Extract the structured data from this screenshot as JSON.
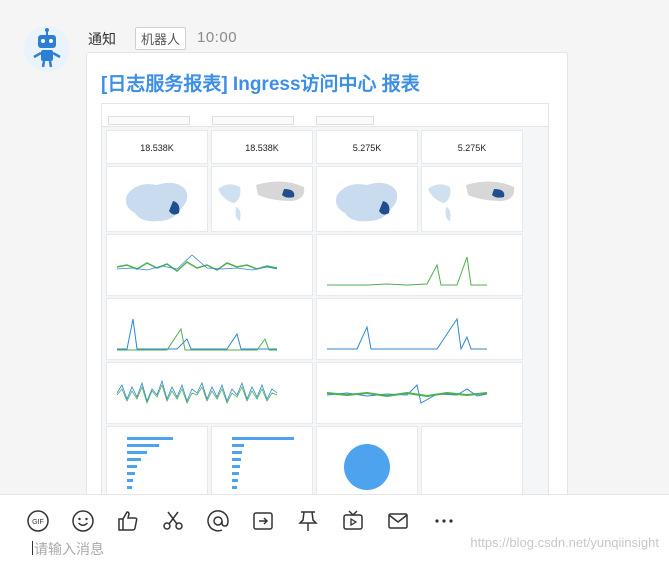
{
  "message": {
    "sender": "通知",
    "badge": "机器人",
    "time": "10:00",
    "title": "[日志服务报表] Ingress访问中心 报表"
  },
  "report": {
    "stats": [
      "18.538K",
      "18.538K",
      "5.275K",
      "5.275K"
    ]
  },
  "toolbar": {
    "icons": [
      "gif-icon",
      "emoji-icon",
      "thumbs-up-icon",
      "scissors-icon",
      "mention-icon",
      "share-icon",
      "pin-icon",
      "video-icon",
      "mail-icon",
      "more-icon"
    ],
    "input_placeholder": "请输入消息"
  },
  "watermark": "https://blog.csdn.net/yunqiinsight",
  "colors": {
    "title": "#3d8fe6",
    "series_green": "#4caf50",
    "series_blue": "#2f86d6"
  }
}
